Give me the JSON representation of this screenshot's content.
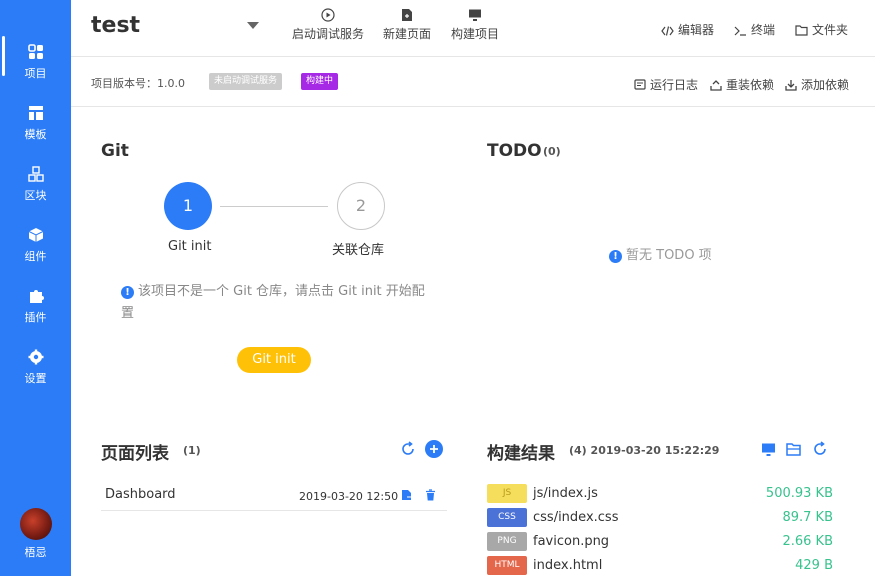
{
  "sidebar": {
    "items": [
      {
        "label": "项目",
        "icon": "grid-icon"
      },
      {
        "label": "模板",
        "icon": "layout-icon"
      },
      {
        "label": "区块",
        "icon": "blocks-icon"
      },
      {
        "label": "组件",
        "icon": "cube-icon"
      },
      {
        "label": "插件",
        "icon": "puzzle-icon"
      },
      {
        "label": "设置",
        "icon": "gear-icon"
      }
    ],
    "user": "梧忌"
  },
  "header": {
    "title": "test",
    "actions": [
      "启动调试服务",
      "新建页面",
      "构建项目"
    ],
    "right_actions": [
      "编辑器",
      "终端",
      "文件夹"
    ]
  },
  "subheader": {
    "version_label": "项目版本号：1.0.0",
    "badge_debug": "未启动调试服务",
    "badge_build": "构建中",
    "actions": [
      "运行日志",
      "重装依赖",
      "添加依赖"
    ]
  },
  "git": {
    "title": "Git",
    "step1_num": "1",
    "step1_label": "Git init",
    "step2_num": "2",
    "step2_label": "关联仓库",
    "message": "该项目不是一个 Git 仓库，请点击 Git init 开始配置",
    "button": "Git init"
  },
  "todo": {
    "title": "TODO",
    "count": "(0)",
    "empty": "暂无 TODO 项"
  },
  "pages": {
    "title": "页面列表",
    "count": "(1)",
    "rows": [
      {
        "name": "Dashboard",
        "date": "2019-03-20 12:50"
      }
    ]
  },
  "build": {
    "title": "构建结果",
    "meta": "(4)  2019-03-20 15:22:29",
    "files": [
      {
        "tag": "JS",
        "name": "js/index.js",
        "size": "500.93 KB",
        "color": "#f5de5b"
      },
      {
        "tag": "CSS",
        "name": "css/index.css",
        "size": "89.7 KB",
        "color": "#4b72d6"
      },
      {
        "tag": "PNG",
        "name": "favicon.png",
        "size": "2.66 KB",
        "color": "#a8a8a8"
      },
      {
        "tag": "HTML",
        "name": "index.html",
        "size": "429 B",
        "color": "#e4664b"
      }
    ]
  },
  "colors": {
    "primary": "#2b7cf6",
    "accent": "#ffc107",
    "success": "#38c28e",
    "badge_purple": "#a629e6"
  }
}
